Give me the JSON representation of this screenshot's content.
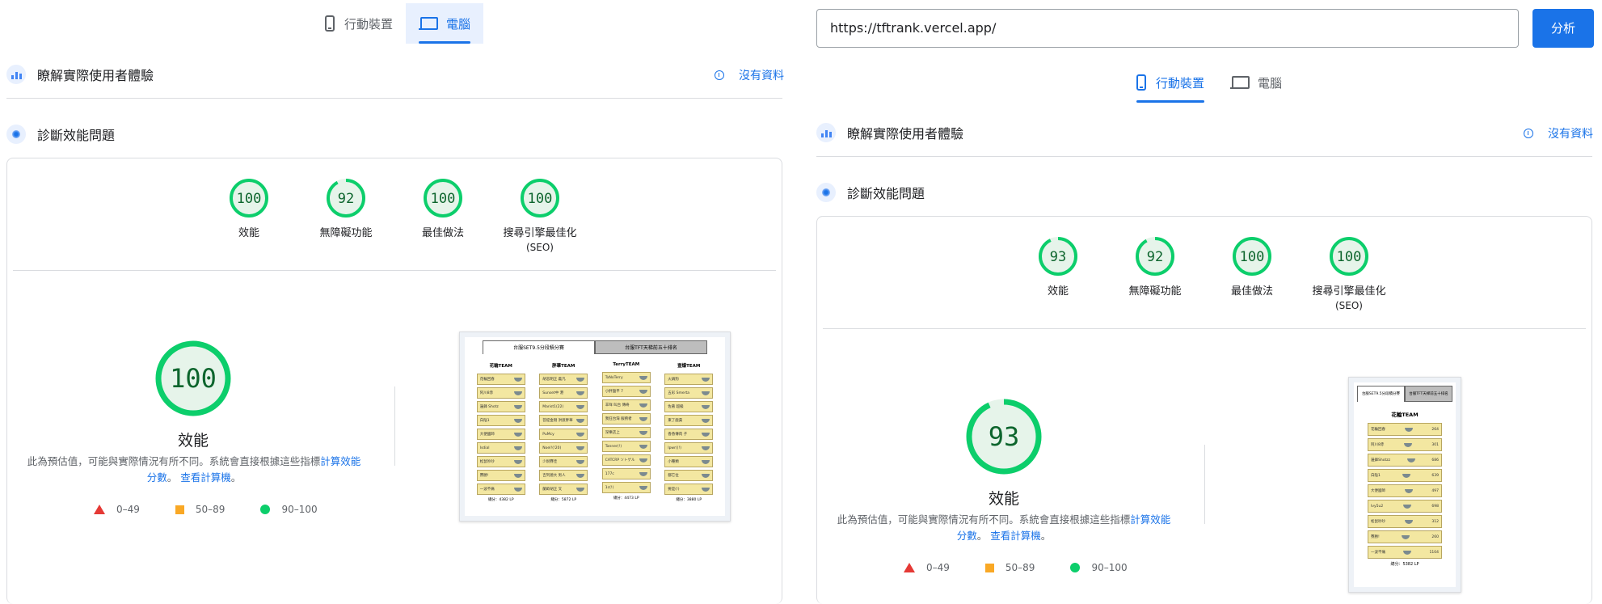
{
  "left": {
    "tabs": [
      {
        "label": "行動裝置",
        "icon": "smartphone-icon",
        "active": false
      },
      {
        "label": "電腦",
        "icon": "laptop-icon",
        "active": true
      }
    ],
    "field_data": {
      "title": "瞭解實際使用者體驗",
      "no_data": "沒有資料"
    },
    "diagnose": {
      "title": "診斷效能問題"
    },
    "scores": [
      {
        "value": "100",
        "label": "效能",
        "sub": ""
      },
      {
        "value": "92",
        "label": "無障礙功能",
        "sub": ""
      },
      {
        "value": "100",
        "label": "最佳做法",
        "sub": ""
      },
      {
        "value": "100",
        "label": "搜尋引擎最佳化",
        "sub": "(SEO)"
      }
    ],
    "main_score": {
      "value": "100",
      "label": "效能"
    },
    "desc_before": "此為預估值，可能與實際情況有所不同。系統會直接根據這些指標",
    "desc_link": "計算效能分數",
    "desc_mid": "。",
    "calc_link": "查看計算機",
    "desc_end": "。",
    "legend": [
      "0–49",
      "50–89",
      "90–100"
    ],
    "thumb": {
      "tab_active": "台服SET9.5分段積分賽",
      "tab_inactive": "台服TFT天梯前五十排名",
      "teams": [
        {
          "name": "花輪TEAM",
          "total": "總分：4382 LP",
          "rows": [
            "花輪回春",
            "阿川8赤",
            "邊鋒 Shotz",
            "白陰1",
            "大便國師",
            "Isdial",
            "松鼠吵吵",
            "賽勝!",
            "一波不痛"
          ]
        },
        {
          "name": "胖華TEAM",
          "total": "總分：5872 LP",
          "rows": [
            "胡志明正 義凡",
            "Sunset中 港",
            "Marist1(22)",
            "菩提金剛 洪渡胖華",
            "PuMcy",
            "Noel!(!20)",
            "少尉賽佳",
            "吉列德大 男人",
            "蘭畝胡正 叉"
          ]
        },
        {
          "name": "TerryTEAM",
          "total": "總分：4473 LP",
          "rows": [
            "TaNoTerry",
            "小胖盤平 7",
            "羊咩 叫台 傳奇",
            "我狂台灣 服務者",
            "深樂店上",
            "Tanner(!)",
            "CATCRP ソトゲル",
            "177c",
            "1c(!)"
          ]
        },
        {
          "name": "壹爆TEAM",
          "total": "總分：3880 LP",
          "rows": [
            "火鍋狗",
            "五彩 Smerta",
            "佐著 超級",
            "東了鹿貴",
            "香香傳肉 子",
            "Ipwr((!)",
            "小種類",
            "都它位",
            "要是(!)"
          ]
        }
      ]
    }
  },
  "right": {
    "url": "https://tftrank.vercel.app/",
    "analyze_label": "分析",
    "tabs": [
      {
        "label": "行動裝置",
        "icon": "smartphone-icon",
        "active": true
      },
      {
        "label": "電腦",
        "icon": "laptop-icon",
        "active": false
      }
    ],
    "field_data": {
      "title": "瞭解實際使用者體驗",
      "no_data": "沒有資料"
    },
    "diagnose": {
      "title": "診斷效能問題"
    },
    "scores": [
      {
        "value": "93",
        "label": "效能",
        "sub": ""
      },
      {
        "value": "92",
        "label": "無障礙功能",
        "sub": ""
      },
      {
        "value": "100",
        "label": "最佳做法",
        "sub": ""
      },
      {
        "value": "100",
        "label": "搜尋引擎最佳化",
        "sub": "(SEO)"
      }
    ],
    "main_score": {
      "value": "93",
      "label": "效能"
    },
    "desc_before": "此為預估值，可能與實際情況有所不同。系統會直接根據這些指標",
    "desc_link": "計算效能分數",
    "desc_mid": "。",
    "calc_link": "查看計算機",
    "desc_end": "。",
    "legend": [
      "0–49",
      "50–89",
      "90–100"
    ],
    "thumb": {
      "tab_active": "台服SET9.5分段積分賽",
      "tab_inactive": "台服TFT天梯前五十排名",
      "team_name": "花輪TEAM",
      "rows": [
        "花輪回春",
        "阿川8赤",
        "邊鋒Shotzz",
        "白陰1",
        "大便國師",
        "Ivy5u2",
        "松鼠吵吵",
        "賽勝!",
        "一波不痛"
      ],
      "values": [
        "264",
        "301",
        "686",
        "639",
        "497",
        "698",
        "312",
        "260",
        "1104"
      ],
      "total": "總分：5382 LP"
    }
  },
  "colors": {
    "accent": "#1a73e8",
    "pass": "#0cce6b",
    "pass_fill": "#e6f4ea",
    "pass_text": "#0d652d",
    "average": "#f9a825",
    "fail": "#e53935"
  }
}
